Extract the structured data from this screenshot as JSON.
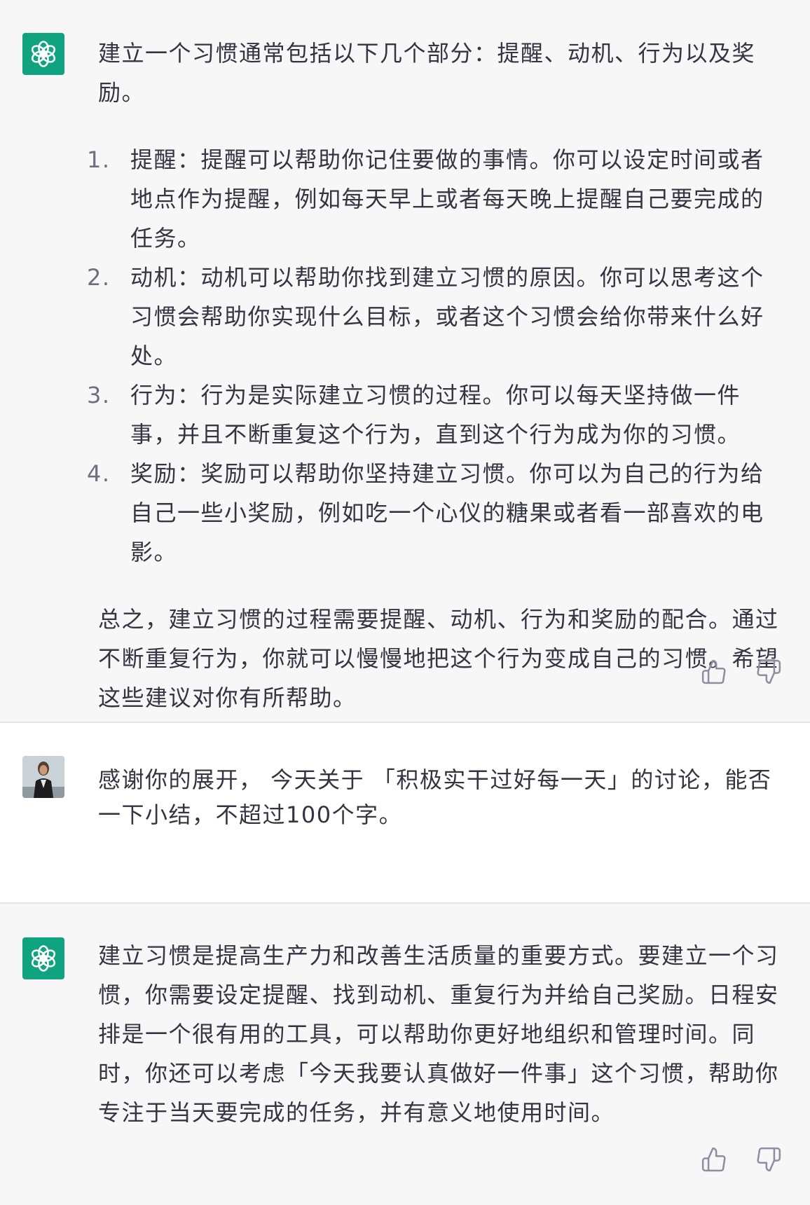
{
  "messages": {
    "first": {
      "intro": "建立一个习惯通常包括以下几个部分：提醒、动机、行为以及奖励。",
      "items": [
        {
          "num": "1.",
          "text": "提醒：提醒可以帮助你记住要做的事情。你可以设定时间或者地点作为提醒，例如每天早上或者每天晚上提醒自己要完成的任务。"
        },
        {
          "num": "2.",
          "text": "动机：动机可以帮助你找到建立习惯的原因。你可以思考这个习惯会帮助你实现什么目标，或者这个习惯会给你带来什么好处。"
        },
        {
          "num": "3.",
          "text": "行为：行为是实际建立习惯的过程。你可以每天坚持做一件事，并且不断重复这个行为，直到这个行为成为你的习惯。"
        },
        {
          "num": "4.",
          "text": "奖励：奖励可以帮助你坚持建立习惯。你可以为自己的行为给自己一些小奖励，例如吃一个心仪的糖果或者看一部喜欢的电影。"
        }
      ],
      "summary": "总之，建立习惯的过程需要提醒、动机、行为和奖励的配合。通过不断重复行为，你就可以慢慢地把这个行为变成自己的习惯。希望这些建议对你有所帮助。"
    },
    "user": {
      "text": "感谢你的展开， 今天关于 「积极实干过好每一天」的讨论，能否一下小结，不超过100个字。"
    },
    "second": {
      "text": "建立习惯是提高生产力和改善生活质量的重要方式。要建立一个习惯，你需要设定提醒、找到动机、重复行为并给自己奖励。日程安排是一个很有用的工具，可以帮助你更好地组织和管理时间。同时，你还可以考虑「今天我要认真做好一件事」这个习惯，帮助你专注于当天要完成的任务，并有意义地使用时间。"
    }
  },
  "icons": {
    "assistant_avatar": "openai-logo-icon",
    "thumbs_up": "thumbs-up-icon",
    "thumbs_down": "thumbs-down-icon"
  },
  "colors": {
    "assistant_bg": "#f7f7f8",
    "user_bg": "#ffffff",
    "brand_green": "#10a37f"
  }
}
